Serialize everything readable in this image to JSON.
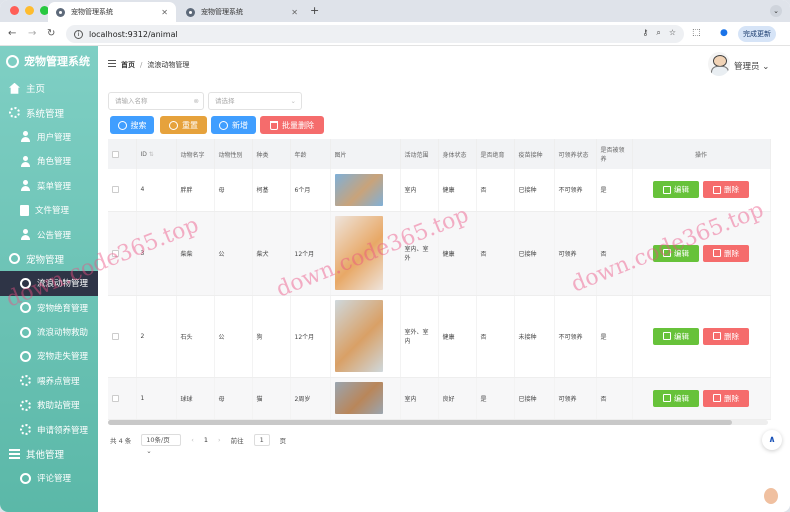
{
  "browser": {
    "tabs": [
      {
        "label": "宠物管理系统"
      },
      {
        "label": "宠物管理系统"
      }
    ],
    "url": "localhost:9312/animal",
    "update_label": "完成更新"
  },
  "app": {
    "title": "宠物管理系统"
  },
  "sidebar": {
    "items": [
      {
        "label": "主页",
        "icon": "home-icon",
        "level": "top"
      },
      {
        "label": "系统管理",
        "icon": "gear-icon",
        "level": "top"
      },
      {
        "label": "用户管理",
        "icon": "person-icon",
        "level": "sub"
      },
      {
        "label": "角色管理",
        "icon": "person-icon",
        "level": "sub"
      },
      {
        "label": "菜单管理",
        "icon": "person-icon",
        "level": "sub"
      },
      {
        "label": "文件管理",
        "icon": "document-icon",
        "level": "sub"
      },
      {
        "label": "公告管理",
        "icon": "person-icon",
        "level": "sub"
      },
      {
        "label": "宠物管理",
        "icon": "pet-icon",
        "level": "top"
      },
      {
        "label": "流浪动物管理",
        "icon": "pet-icon",
        "level": "sub",
        "active": true
      },
      {
        "label": "宠物绝育管理",
        "icon": "ring-icon",
        "level": "sub"
      },
      {
        "label": "流浪动物救助",
        "icon": "ring-icon",
        "level": "sub"
      },
      {
        "label": "宠物走失管理",
        "icon": "ring-icon",
        "level": "sub"
      },
      {
        "label": "喂养点管理",
        "icon": "gear-icon",
        "level": "sub"
      },
      {
        "label": "救助站管理",
        "icon": "gear-icon",
        "level": "sub"
      },
      {
        "label": "申请领养管理",
        "icon": "gear-icon",
        "level": "sub"
      },
      {
        "label": "其他管理",
        "icon": "list-icon",
        "level": "top"
      },
      {
        "label": "评论管理",
        "icon": "ring-icon",
        "level": "sub"
      }
    ]
  },
  "header": {
    "breadcrumb_home": "首页",
    "breadcrumb_sep": "/",
    "breadcrumb_current": "流浪动物管理",
    "user": "管理员"
  },
  "filters": {
    "name_placeholder": "请输入名称",
    "select_placeholder": "请选择"
  },
  "toolbar": {
    "search": "搜索",
    "reset": "重置",
    "add": "新增",
    "batch_delete": "批量删除"
  },
  "table": {
    "headers": [
      "ID",
      "动物名字",
      "动物性别",
      "种类",
      "年龄",
      "图片",
      "活动范围",
      "身体状态",
      "是否绝育",
      "疫苗接种",
      "可领养状态",
      "是否被领养",
      "操作"
    ],
    "rows": [
      {
        "id": "4",
        "name": "胖胖",
        "gender": "母",
        "kind": "柯基",
        "age": "6个月",
        "range": "室内",
        "health": "健康",
        "neutered": "否",
        "vaccine": "已接种",
        "adoptable": "不可领养",
        "adopted": "是"
      },
      {
        "id": "3",
        "name": "柴柴",
        "gender": "公",
        "kind": "柴犬",
        "age": "12个月",
        "range": "室内、室外",
        "health": "健康",
        "neutered": "否",
        "vaccine": "已接种",
        "adoptable": "可领养",
        "adopted": "否"
      },
      {
        "id": "2",
        "name": "石头",
        "gender": "公",
        "kind": "狗",
        "age": "12个月",
        "range": "室外、室内",
        "health": "健康",
        "neutered": "否",
        "vaccine": "未接种",
        "adoptable": "不可领养",
        "adopted": "是"
      },
      {
        "id": "1",
        "name": "球球",
        "gender": "母",
        "kind": "猫",
        "age": "2周岁",
        "range": "室内",
        "health": "良好",
        "neutered": "是",
        "vaccine": "已接种",
        "adoptable": "可领养",
        "adopted": "否"
      }
    ],
    "edit_label": "编辑",
    "delete_label": "删除"
  },
  "pagination": {
    "total": "共 4 条",
    "page_size": "10条/页",
    "prev": "‹",
    "page": "1",
    "next": "›",
    "goto_label": "前往",
    "goto_value": "1",
    "page_suffix": "页"
  },
  "watermark": "down.code365.top"
}
